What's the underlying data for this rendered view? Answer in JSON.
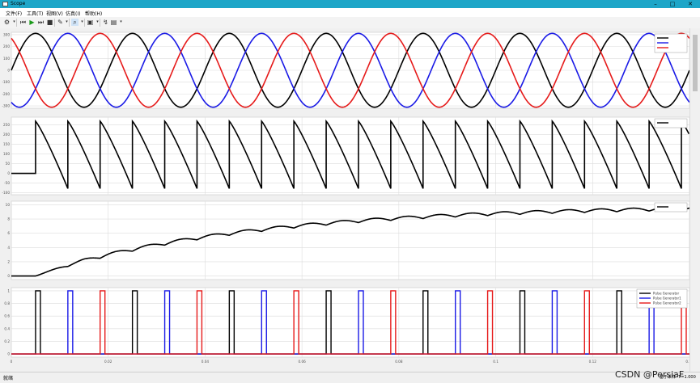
{
  "window": {
    "title": "Scope"
  },
  "menu": [
    "文件(F)",
    "工具(T)",
    "视图(V)",
    "仿真(I)",
    "帮助(H)"
  ],
  "status": {
    "left": "就绪",
    "sample_mode": "基于采样",
    "time_offset": "T=1.000",
    "watermark": "CSDN @PersiaF"
  },
  "colors": {
    "black": "#000000",
    "blue": "#1a1ae6",
    "red": "#e61a1a",
    "axis_bg": "#ffffff",
    "grid": "#dcdcdc"
  },
  "chart_data": [
    {
      "type": "line",
      "xlim": [
        0,
        0.14
      ],
      "ylim": [
        -320,
        320
      ],
      "y_ticks": [
        "300",
        "200",
        "100",
        "0",
        "-100",
        "-200",
        "-300"
      ],
      "legend_position": "top-right",
      "legend_entries": [
        "",
        "",
        ""
      ],
      "series": [
        {
          "color": "black",
          "amplitude": 311,
          "frequency": 50,
          "phase_deg": 0
        },
        {
          "color": "blue",
          "amplitude": 311,
          "frequency": 50,
          "phase_deg": -120
        },
        {
          "color": "red",
          "amplitude": 311,
          "frequency": 50,
          "phase_deg": 120
        }
      ],
      "grid": true
    },
    {
      "type": "line",
      "xlim": [
        0,
        0.14
      ],
      "ylim": [
        -110,
        290
      ],
      "y_ticks": [
        "250",
        "200",
        "150",
        "100",
        "50",
        "0",
        "-50",
        "-100"
      ],
      "legend_position": "top-right",
      "legend_entries": [
        ""
      ],
      "description_values": {
        "initial_level": 0,
        "start_time": 0.005,
        "peak": 269,
        "trough": -78
      },
      "grid": true
    },
    {
      "type": "line",
      "xlim": [
        0,
        0.14
      ],
      "ylim": [
        -0.5,
        10.5
      ],
      "y_ticks": [
        "10",
        "8",
        "6",
        "4",
        "2",
        "0"
      ],
      "legend_position": "top-right",
      "legend_entries": [
        ""
      ],
      "description_values": {
        "final_value": 9.7,
        "start_time": 0.005,
        "ripple": 0.45
      },
      "grid": true
    },
    {
      "type": "line",
      "xlim": [
        0,
        0.14
      ],
      "ylim": [
        -0.05,
        1.05
      ],
      "y_ticks": [
        "1",
        "0.8",
        "0.6",
        "0.4",
        "0.2",
        "0"
      ],
      "x_ticks": [
        "0",
        "0.02",
        "0.04",
        "0.06",
        "0.08",
        "0.1",
        "0.12",
        "0.14"
      ],
      "legend_position": "top-right",
      "legend_entries": [
        "Pulse Generator",
        "Pulse Generator1",
        "Pulse Generator2"
      ],
      "series": [
        {
          "name": "Pulse Generator",
          "color": "black",
          "period": 0.02,
          "first_pulse": 0.005,
          "pulse_width": 0.001
        },
        {
          "name": "Pulse Generator1",
          "color": "blue",
          "period": 0.02,
          "first_pulse": 0.01167,
          "pulse_width": 0.001
        },
        {
          "name": "Pulse Generator2",
          "color": "red",
          "period": 0.02,
          "first_pulse": 0.01833,
          "pulse_width": 0.001
        }
      ],
      "grid": true
    }
  ]
}
